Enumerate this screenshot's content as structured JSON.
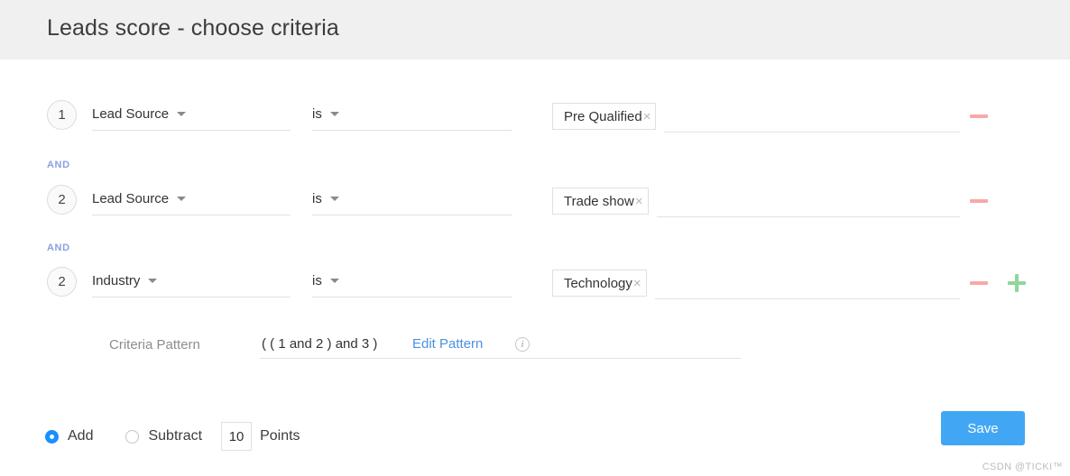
{
  "header": {
    "title": "Leads score - choose criteria"
  },
  "criteria": {
    "connector_label": "AND",
    "rows": [
      {
        "index": "1",
        "attribute": "Lead Source",
        "operator": "is",
        "value_chip": "Pre Qualified",
        "chip_remove": "×",
        "value_input": "",
        "value_placeholder": "",
        "minus_label": "remove-criteria",
        "has_plus": false
      },
      {
        "index": "2",
        "attribute": "Lead Source",
        "operator": "is",
        "value_chip": "Trade show",
        "chip_remove": "×",
        "value_input": "",
        "value_placeholder": "",
        "minus_label": "remove-criteria",
        "has_plus": false
      },
      {
        "index": "2",
        "attribute": "Industry",
        "operator": "is",
        "value_chip": "Technology",
        "chip_remove": "×",
        "value_input": "",
        "value_placeholder": "",
        "minus_label": "remove-criteria",
        "has_plus": true
      }
    ]
  },
  "pattern": {
    "label": "Criteria Pattern",
    "value": "( ( 1 and 2 ) and 3 )",
    "edit_link": "Edit Pattern",
    "info_glyph": "i"
  },
  "footer": {
    "add_label": "Add",
    "subtract_label": "Subtract",
    "add_selected": true,
    "points_value": "10",
    "points_label": "Points",
    "save_label": "Save"
  },
  "watermark": "CSDN @TICKI™",
  "colors": {
    "header_bg": "#f0f0f0",
    "accent_blue": "#41a7f5",
    "radio_blue": "#1890ff",
    "and_text": "#8c9fe0",
    "minus_red": "#f7a8a8",
    "plus_green": "#8fd79a",
    "link_blue": "#4a90e2"
  }
}
